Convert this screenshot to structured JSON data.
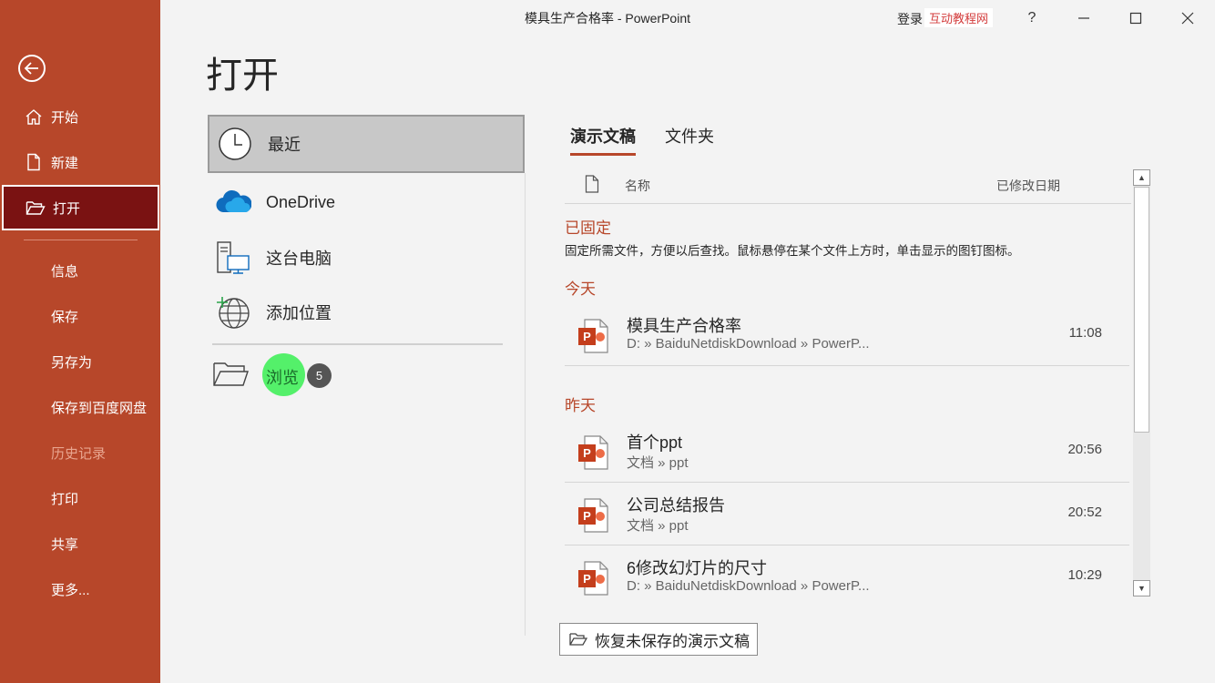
{
  "window": {
    "title": "模具生产合格率  -  PowerPoint",
    "login_label": "登录",
    "watermark": "互动教程网",
    "help_label": "?"
  },
  "sidebar": {
    "items": [
      {
        "label": "开始",
        "icon": "home-icon"
      },
      {
        "label": "新建",
        "icon": "new-file-icon"
      },
      {
        "label": "打开",
        "icon": "open-folder-icon"
      },
      {
        "label": "信息"
      },
      {
        "label": "保存"
      },
      {
        "label": "另存为"
      },
      {
        "label": "保存到百度网盘"
      },
      {
        "label": "历史记录"
      },
      {
        "label": "打印"
      },
      {
        "label": "共享"
      },
      {
        "label": "更多..."
      }
    ]
  },
  "main": {
    "heading": "打开",
    "locations": [
      {
        "label": "最近",
        "icon": "clock-icon"
      },
      {
        "label": "OneDrive",
        "icon": "onedrive-cloud-icon"
      },
      {
        "label": "这台电脑",
        "icon": "this-pc-icon"
      },
      {
        "label": "添加位置",
        "icon": "add-location-globe-icon"
      }
    ],
    "browse": {
      "label": "浏览",
      "badge": "5"
    },
    "tabs": [
      {
        "label": "演示文稿"
      },
      {
        "label": "文件夹"
      }
    ],
    "list_header": {
      "name": "名称",
      "date": "已修改日期"
    },
    "pinned": {
      "title": "已固定",
      "desc": "固定所需文件，方便以后查找。鼠标悬停在某个文件上方时，单击显示的图钉图标。"
    },
    "groups": [
      {
        "title": "今天",
        "files": [
          {
            "name": "模具生产合格率",
            "path": "D: » BaiduNetdiskDownload » PowerP...",
            "time": "11:08"
          }
        ]
      },
      {
        "title": "昨天",
        "files": [
          {
            "name": "首个ppt",
            "path": "文档 » ppt",
            "time": "20:56"
          },
          {
            "name": "公司总结报告",
            "path": "文档 » ppt",
            "time": "20:52"
          },
          {
            "name": "6修改幻灯片的尺寸",
            "path": "D: » BaiduNetdiskDownload » PowerP...",
            "time": "10:29"
          }
        ]
      }
    ],
    "recover_button": "恢复未保存的演示文稿"
  },
  "colors": {
    "sidebar_bg": "#b7472a",
    "active_item_bg": "#7a1212",
    "accent": "#b7472a"
  }
}
